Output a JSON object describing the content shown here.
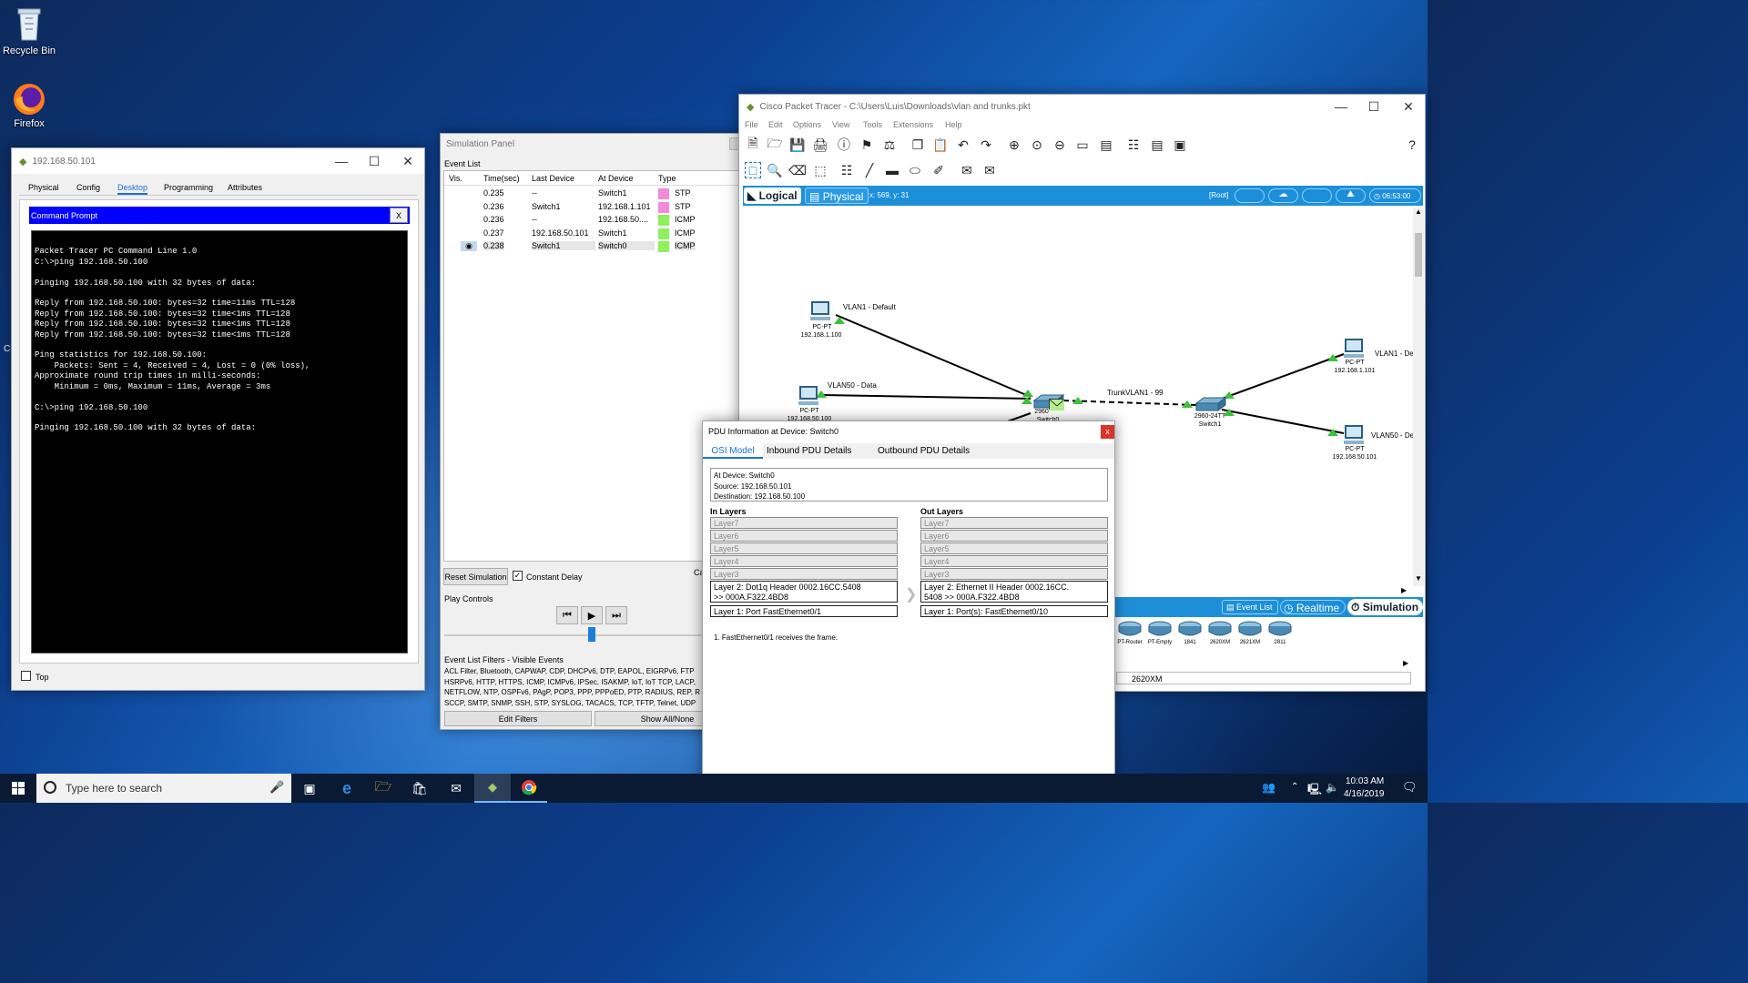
{
  "desktop": {
    "icons": [
      {
        "label": "Recycle Bin"
      },
      {
        "label": "Firefox"
      }
    ],
    "edge_glyph": "Ci"
  },
  "pc_window": {
    "title": "192.168.50.101",
    "tabs": [
      "Physical",
      "Config",
      "Desktop",
      "Programming",
      "Attributes"
    ],
    "active_tab": "Desktop",
    "cmd_title": "Command Prompt",
    "cmd_close": "X",
    "cmd_lines": [
      "",
      "Packet Tracer PC Command Line 1.0",
      "C:\\>ping 192.168.50.100",
      "",
      "Pinging 192.168.50.100 with 32 bytes of data:",
      "",
      "Reply from 192.168.50.100: bytes=32 time=11ms TTL=128",
      "Reply from 192.168.50.100: bytes=32 time<1ms TTL=128",
      "Reply from 192.168.50.100: bytes=32 time<1ms TTL=128",
      "Reply from 192.168.50.100: bytes=32 time<1ms TTL=128",
      "",
      "Ping statistics for 192.168.50.100:",
      "    Packets: Sent = 4, Received = 4, Lost = 0 (0% loss),",
      "Approximate round trip times in milli-seconds:",
      "    Minimum = 0ms, Maximum = 11ms, Average = 3ms",
      "",
      "C:\\>ping 192.168.50.100",
      "",
      "Pinging 192.168.50.100 with 32 bytes of data:"
    ],
    "top_checkbox_label": "Top"
  },
  "sim_panel": {
    "title": "Simulation Panel",
    "event_list_label": "Event List",
    "columns": [
      "Vis.",
      "Time(sec)",
      "Last Device",
      "At Device",
      "Type"
    ],
    "events": [
      {
        "time": "0.235",
        "last": "--",
        "at": "Switch1",
        "type": "STP",
        "color": "#f38ad9"
      },
      {
        "time": "0.236",
        "last": "Switch1",
        "at": "192.168.1.101",
        "type": "STP",
        "color": "#f38ad9"
      },
      {
        "time": "0.236",
        "last": "--",
        "at": "192.168.50....",
        "type": "ICMP",
        "color": "#8ef05a"
      },
      {
        "time": "0.237",
        "last": "192.168.50.101",
        "at": "Switch1",
        "type": "ICMP",
        "color": "#8ef05a"
      },
      {
        "time": "0.238",
        "last": "Switch1",
        "at": "Switch0",
        "type": "ICMP",
        "color": "#8ef05a"
      }
    ],
    "reset_label": "Reset Simulation",
    "constant_delay_label": "Constant Delay",
    "cut_label": "Ca",
    "play_controls_label": "Play Controls",
    "filters_label": "Event List Filters - Visible Events",
    "filters_text": [
      "ACL Filter, Bluetooth, CAPWAP, CDP, DHCPv6, DTP, EAPOL, EIGRPv6, FTP",
      "HSRPv6, HTTP, HTTPS, ICMP, ICMPv6, IPSec, ISAKMP, IoT, IoT TCP, LACP,",
      "NETFLOW, NTP, OSPFv6, PAgP, POP3, PPP, PPPoED, PTP, RADIUS, REP, R",
      "SCCP, SMTP, SNMP, SSH, STP, SYSLOG, TACACS, TCP, TFTP, Telnet, UDP"
    ],
    "edit_filters_label": "Edit Filters",
    "show_all_label": "Show All/None"
  },
  "pt_window": {
    "title": "Cisco Packet Tracer - C:\\Users\\Luis\\Downloads\\vlan and trunks.pkt",
    "menu": [
      "File",
      "Edit",
      "Options",
      "View",
      "Tools",
      "Extensions",
      "Help"
    ],
    "logical_label": "Logical",
    "physical_label": "Physical",
    "coords": "x: 569, y: 31",
    "root_label": "[Root]",
    "clock": "06:53:00",
    "topology": {
      "labels": {
        "vlan1_default": "VLAN1 - Default",
        "vlan50_data": "VLAN50 - Data",
        "pc1_name": "PC-PT",
        "pc1_ip": "192.168.1.100",
        "pc2_name": "PC-PT",
        "pc2_ip": "192.168.50.100",
        "switch0_model": "2960",
        "switch0_name": "Switch0",
        "trunk": "TrunkVLAN1 - 99",
        "switch1_model": "2960-24TT",
        "switch1_name": "Switch1",
        "right_vlan1": "VLAN1 - De",
        "pc3_name": "PC-PT",
        "pc3_ip": "192.168.1.101",
        "right_vlan50": "VLAN50 - De",
        "pc4_name": "PC-PT",
        "pc4_ip": "192.168.50.101"
      }
    },
    "bottom_bar": {
      "event_list": "Event List",
      "realtime": "Realtime",
      "simulation": "Simulation"
    },
    "device_palette": [
      "PT-Router",
      "PT-Empty",
      "1841",
      "2620XM",
      "2621XM",
      "2811"
    ],
    "selected_device": "2620XM"
  },
  "pdu_window": {
    "title": "PDU Information at Device: Switch0",
    "close": "x",
    "tabs": [
      "OSI Model",
      "Inbound PDU Details",
      "Outbound PDU Details"
    ],
    "active_tab": "OSI Model",
    "info": [
      "At Device: Switch0",
      "Source: 192.168.50.101",
      "Destination: 192.168.50.100"
    ],
    "in_layers_label": "In Layers",
    "out_layers_label": "Out Layers",
    "in_layers": [
      "Layer7",
      "Layer6",
      "Layer5",
      "Layer4",
      "Layer3"
    ],
    "out_layers": [
      "Layer7",
      "Layer6",
      "Layer5",
      "Layer4",
      "Layer3"
    ],
    "in_layer2": [
      "Layer 2: Dot1q Header 0002.16CC.5408",
      ">> 000A.F322.4BD8"
    ],
    "in_layer1": "Layer 1: Port FastEthernet0/1",
    "out_layer2": [
      "Layer 2: Ethernet II Header 0002.16CC.",
      "5408 >> 000A.F322.4BD8"
    ],
    "out_layer1": "Layer 1: Port(s): FastEthernet0/10",
    "description": "1. FastEthernet0/1 receives the frame."
  },
  "taskbar": {
    "search_placeholder": "Type here to search",
    "time": "10:03 AM",
    "date": "4/16/2019"
  }
}
